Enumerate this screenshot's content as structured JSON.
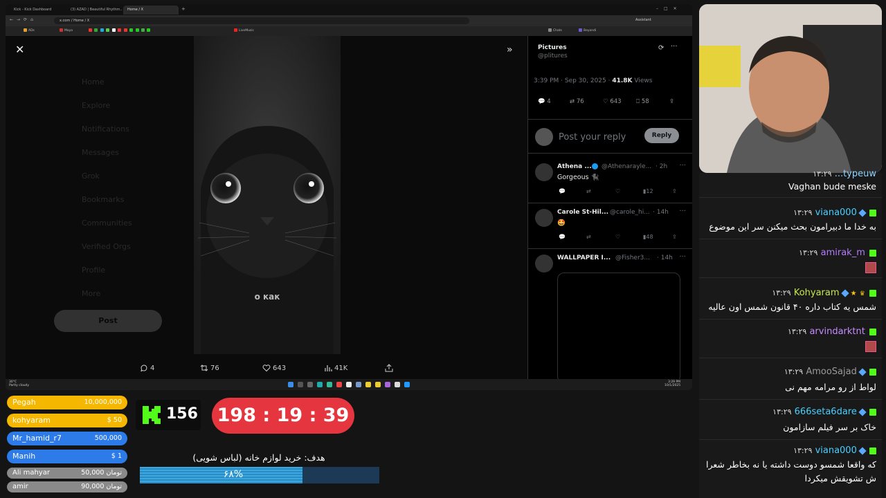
{
  "browser": {
    "tabs": [
      "Kick - Kick Dashboard",
      "(3) AZAD | Beautiful Rhythm...",
      "Home / X"
    ],
    "url": "x.com / Home / X",
    "bookmarks": [
      "ADs",
      "Maya",
      "LiveMusic",
      "Chats",
      "Beyondi",
      "Assistant"
    ]
  },
  "tweet": {
    "caption": "о как",
    "ghost_nav": [
      "Home",
      "Explore",
      "Notifications",
      "Messages",
      "Grok",
      "Bookmarks",
      "Communities",
      "Verified Orgs",
      "Profile",
      "More",
      "Post"
    ],
    "actions": {
      "replies": "4",
      "reposts": "76",
      "likes": "643",
      "views": "41K"
    }
  },
  "side": {
    "source_name": "Pictures",
    "source_handle": "@plitures",
    "date": "3:39 PM · Sep 30, 2025",
    "views": "41.8K",
    "views_label": "Views",
    "stats": {
      "replies": "4",
      "reposts": "76",
      "likes": "643",
      "bookmarks": "58"
    },
    "reply_placeholder": "Post your reply",
    "reply_button": "Reply",
    "replies": [
      {
        "name": "Athena ...",
        "handle": "@Athenarayle...",
        "time": "· 2h",
        "text": "Gorgeous 🐈‍⬛",
        "views": "12"
      },
      {
        "name": "Carole St-Hil...",
        "handle": "@carole_hi...",
        "time": "· 14h",
        "text": "🤩",
        "views": "48"
      },
      {
        "name": "WALLPAPER I...",
        "handle": "@Fisher3...",
        "time": "· 14h",
        "text": ""
      }
    ]
  },
  "taskbar": {
    "weather_temp": "30°C",
    "weather_desc": "Partly cloudy",
    "time": "3:29 PM",
    "date": "10/1/2025"
  },
  "chat": {
    "messages": [
      {
        "user": "...typeuw",
        "time": "۱۳:۲۹",
        "text": "Vaghan bude meske",
        "color": "#8fd3ff"
      },
      {
        "user": "viana000",
        "time": "۱۳:۲۹",
        "text": "به خدا ما دبیرامون بحث میکنن سر این موضوع",
        "color": "#4ad0ff"
      },
      {
        "user": "amirak_m",
        "time": "۱۳:۲۹",
        "text": "",
        "color": "#b27cff"
      },
      {
        "user": "Kohyaram",
        "time": "۱۳:۲۹",
        "text": "شمس یه کتاب داره ۴۰ قانون شمس اون عالیه",
        "color": "#c6e84a"
      },
      {
        "user": "arvindarktnt",
        "time": "۱۳:۲۹",
        "text": "",
        "color": "#c58cff"
      },
      {
        "user": "AmooSajad",
        "time": "۱۳:۲۹",
        "text": "لواط از رو مرامه مهم نی",
        "color": "#9a9a9a"
      },
      {
        "user": "666seta6dare",
        "time": "۱۳:۲۹",
        "text": "خاک بر سر فیلم سازامون",
        "color": "#4ad0ff"
      },
      {
        "user": "viana000",
        "time": "۱۳:۲۹",
        "text": "که واقعا شمسو دوست داشته یا نه بخاطر شعرا",
        "text2": "ش تشویقش میکردا",
        "color": "#4ad0ff"
      }
    ]
  },
  "donors": [
    {
      "name": "Pegah",
      "amount": "10,000,000",
      "bg": "#f5b700"
    },
    {
      "name": "kohyaram",
      "amount": "$ 50",
      "bg": "#f5b700"
    },
    {
      "name": "Mr_hamid_r7",
      "amount": "500,000",
      "bg": "#2d7be8"
    },
    {
      "name": "Manih",
      "amount": "$ 1",
      "bg": "#2d7be8"
    },
    {
      "name": "Ali mahyar",
      "amount": "50,000 تومان",
      "bg": "#8a8a8a"
    },
    {
      "name": "amir",
      "amount": "90,000 تومان",
      "bg": "#8a8a8a"
    }
  ],
  "kick": {
    "count": "156",
    "color": "#53fc18"
  },
  "timer": {
    "h": "198",
    "m": "19",
    "s": "39",
    "display": "198 : 19 : 39"
  },
  "goal": {
    "title": "هدف: خرید لوازم خانه (لباس شویی)",
    "percent_label": "۶۸%",
    "percent": 68
  }
}
